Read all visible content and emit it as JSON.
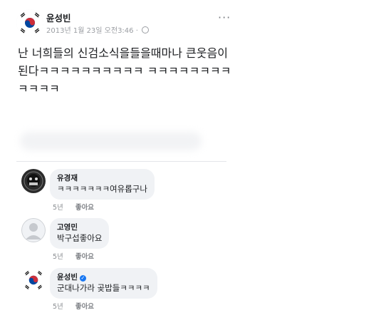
{
  "post": {
    "author": "윤성빈",
    "timestamp": "2013년 1월 23일 오전3:46 ·",
    "privacy_icon": "globe-icon",
    "more_label": "···",
    "text": "난 너희들의 신검소식을들을때마나 큰웃음이된다ㅋㅋㅋㅋㅋㅋㅋㅋㅋㅋ ㅋㅋㅋㅋㅋㅋㅋㅋㅋㅋㅋㅋ"
  },
  "comments": [
    {
      "name": "유경재",
      "text": "ㅋㅋㅋㅋㅋㅋㅋ여유롭구나",
      "age": "5년",
      "like_label": "좋아요",
      "verified": false,
      "avatar": "dark-profile-photo"
    },
    {
      "name": "고영민",
      "text": "박구섭좋아요",
      "age": "5년",
      "like_label": "좋아요",
      "verified": false,
      "avatar": "default-avatar-silhouette"
    },
    {
      "name": "윤성빈",
      "text": "군대나가라 곶밥들ㅋㅋㅋㅋ",
      "age": "5년",
      "like_label": "좋아요",
      "verified": true,
      "avatar": "korean-flag-avatar"
    }
  ],
  "colors": {
    "bubble": "#f0f2f5",
    "meta_text": "#9a9da2",
    "verified": "#1877f2",
    "flag_red": "#cd2e3a",
    "flag_blue": "#0047a0"
  }
}
